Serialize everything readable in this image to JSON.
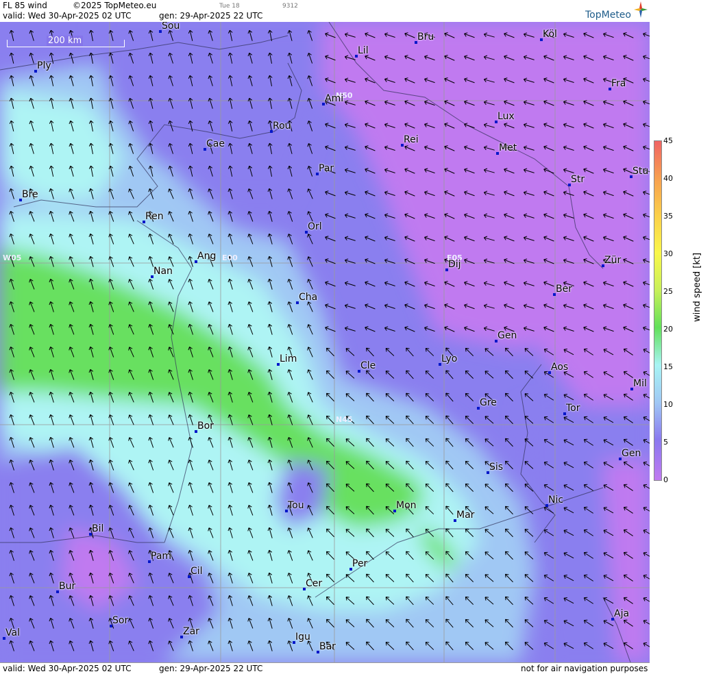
{
  "header": {
    "title": "FL 85 wind",
    "copyright": "©2025 TopMeteo.eu",
    "day_code": "Tue 18",
    "num_code": "9312",
    "valid": "valid:  Wed  30-Apr-2025  02 UTC",
    "gen": "gen: 29-Apr-2025 22 UTC",
    "brand": "TopMeteo"
  },
  "footer": {
    "valid": "valid:  Wed  30-Apr-2025  02 UTC",
    "gen": "gen: 29-Apr-2025 22 UTC",
    "disclaimer": "not for air navigation purposes"
  },
  "map": {
    "scale_label": "200 km",
    "grid_labels": [
      "N50",
      "W05",
      "E00",
      "E05",
      "N45"
    ],
    "cities": [
      "Sou",
      "Bru",
      "Köl",
      "Ply",
      "Lil",
      "Ami",
      "Fra",
      "Lux",
      "Rou",
      "Rei",
      "Cae",
      "Met",
      "Par",
      "Stu",
      "Str",
      "Bre",
      "Ren",
      "Orl",
      "Ang",
      "Dij",
      "Zür",
      "Nan",
      "Ber",
      "Cha",
      "Gen",
      "Lim",
      "Cle",
      "Lyo",
      "Aos",
      "Mil",
      "Gre",
      "Tor",
      "Bor",
      "Gen",
      "Sis",
      "Nic",
      "Tou",
      "Mon",
      "Mar",
      "Bil",
      "Pam",
      "Per",
      "Cil",
      "Bur",
      "Cer",
      "Sor",
      "Aja",
      "Val",
      "Zar",
      "Igu",
      "Bar"
    ]
  },
  "legend": {
    "title": "wind speed [kt]",
    "ticks": [
      "45",
      "40",
      "35",
      "30",
      "25",
      "20",
      "15",
      "10",
      "5",
      "0"
    ],
    "colors": [
      "#f06464",
      "#f7a050",
      "#fbd04a",
      "#f9f74a",
      "#c8f05a",
      "#62e05a",
      "#a8f4f4",
      "#a0c8f4",
      "#8a7aef",
      "#c07af0"
    ]
  }
}
